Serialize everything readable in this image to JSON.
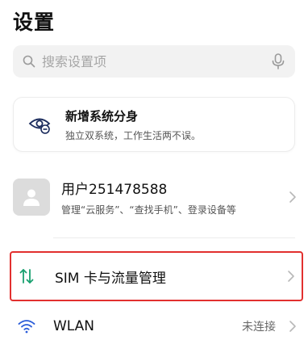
{
  "header": {
    "title": "设置"
  },
  "search": {
    "placeholder": "搜索设置项"
  },
  "feature_card": {
    "title": "新增系统分身",
    "subtitle": "独立双系统，工作生活两不误。"
  },
  "account": {
    "name": "用户251478588",
    "subtitle": "管理“云服务”、“查找手机”、登录设备等"
  },
  "settings": {
    "sim": {
      "label": "SIM 卡与流量管理"
    },
    "wlan": {
      "label": "WLAN",
      "status": "未连接"
    }
  },
  "colors": {
    "highlight_border": "#e2302f",
    "sim_icon": "#18a06f",
    "feature_icon": "#1a2b5c"
  }
}
